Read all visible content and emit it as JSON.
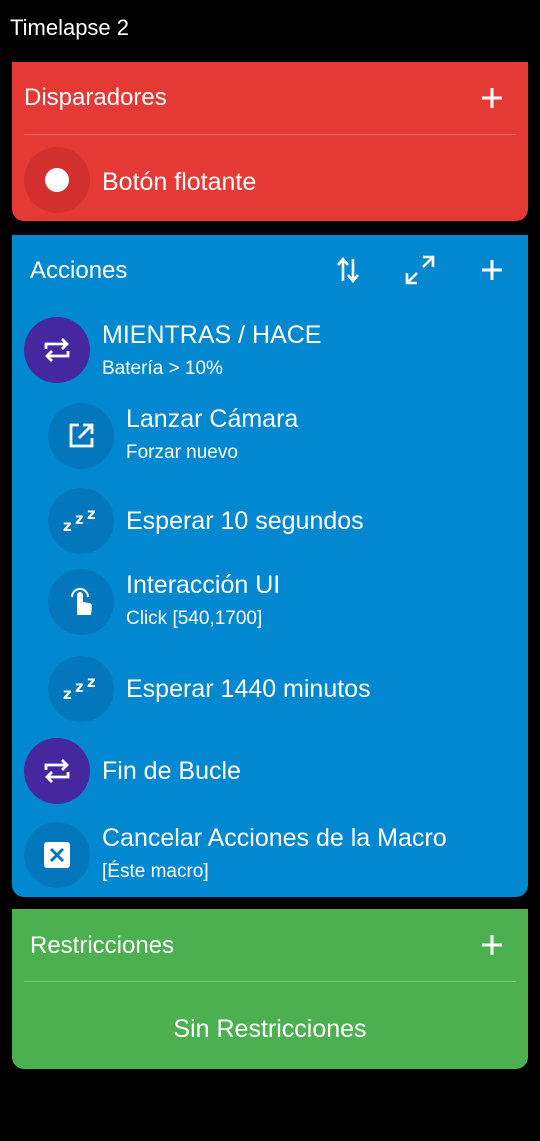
{
  "header": {
    "title": "Timelapse 2"
  },
  "triggers": {
    "title": "Disparadores",
    "add_icon": "plus-icon",
    "items": [
      {
        "title": "Botón flotante",
        "icon": "floating-button-icon"
      }
    ],
    "colors": {
      "card": "#e53935",
      "icon_bg": "#d32f2f"
    }
  },
  "actions": {
    "title": "Acciones",
    "header_icons": [
      "reorder-icon",
      "expand-icon",
      "plus-icon"
    ],
    "items": [
      {
        "title": "MIENTRAS / HACE",
        "subtitle": "Batería > 10%",
        "icon": "loop-icon"
      },
      {
        "title": "Lanzar Cámara",
        "subtitle": "Forzar nuevo",
        "icon": "launch-icon"
      },
      {
        "title": "Esperar 10 segundos",
        "icon": "sleep-icon"
      },
      {
        "title": "Interacción UI",
        "subtitle": "Click [540,1700]",
        "icon": "touch-icon"
      },
      {
        "title": "Esperar 1440 minutos",
        "icon": "sleep-icon"
      },
      {
        "title": "Fin de Bucle",
        "icon": "loop-icon"
      },
      {
        "title": "Cancelar Acciones de la Macro",
        "subtitle": "[Éste macro]",
        "icon": "cancel-icon"
      }
    ],
    "colors": {
      "card": "#0288d1",
      "icon_bg": "#0277bd",
      "loop_bg": "#4527a0"
    }
  },
  "constraints": {
    "title": "Restricciones",
    "add_icon": "plus-icon",
    "empty_text": "Sin Restricciones",
    "colors": {
      "card": "#4caf50"
    }
  }
}
